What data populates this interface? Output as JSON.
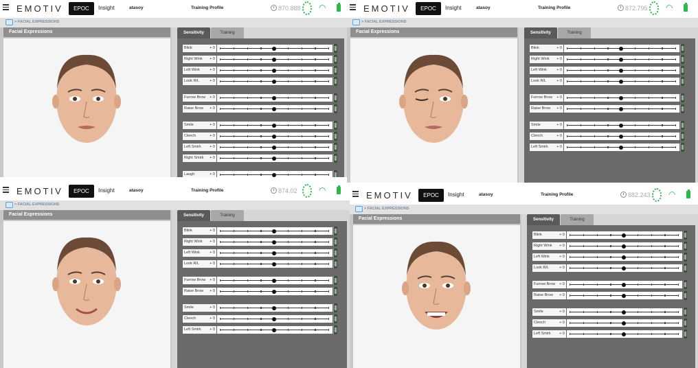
{
  "screens": [
    {
      "menu_icon": "hamburger-icon",
      "logo": "EMOTIV",
      "tabs": {
        "epoc": "EPOC",
        "insight": "Insight"
      },
      "user": "atasoy",
      "profile_label": "Training Profile",
      "counter": "870.888",
      "breadcrumb": "> FACIAL EXPRESSIONS",
      "panel_title": "Facial Expressions",
      "sensitivity_tab": "Sensitivity",
      "training_tab": "Training",
      "expression": "neutral",
      "sliders": [
        {
          "label": "Blink",
          "value": "+ 0",
          "level": 0.5
        },
        {
          "label": "Right Wink",
          "value": "+ 0",
          "level": 0.5
        },
        {
          "label": "Left Wink",
          "value": "+ 0",
          "level": 0.5
        },
        {
          "label": "Look R/L",
          "value": "+ 0",
          "level": 0.5
        },
        {
          "label": "Furrow Brow",
          "value": "+ 0",
          "level": 0.5,
          "gap": true
        },
        {
          "label": "Raise Brow",
          "value": "+ 0",
          "level": 0.5
        },
        {
          "label": "Smile",
          "value": "+ 0",
          "level": 0.5,
          "gap": true
        },
        {
          "label": "Clench",
          "value": "+ 0",
          "level": 0.5
        },
        {
          "label": "Left Smirk",
          "value": "+ 0",
          "level": 0.5
        },
        {
          "label": "Right Smirk",
          "value": "+ 0",
          "level": 0.5
        },
        {
          "label": "Laugh",
          "value": "+ 0",
          "level": 0.5,
          "gap": true
        }
      ]
    },
    {
      "menu_icon": "hamburger-icon",
      "logo": "EMOTIV",
      "tabs": {
        "epoc": "EPOC",
        "insight": "Insight"
      },
      "user": "atasoy",
      "profile_label": "Training Profile",
      "counter": "872.795",
      "breadcrumb": "> FACIAL EXPRESSIONS",
      "panel_title": "Facial Expressions",
      "sensitivity_tab": "Sensitivity",
      "training_tab": "Training",
      "expression": "wink",
      "sliders": [
        {
          "label": "Blink",
          "value": "+ 0",
          "level": 0.5
        },
        {
          "label": "Right Wink",
          "value": "+ 0",
          "level": 0.5
        },
        {
          "label": "Left Wink",
          "value": "+ 0",
          "level": 0.5
        },
        {
          "label": "Look R/L",
          "value": "+ 0",
          "level": 0.5
        },
        {
          "label": "Furrow Brow",
          "value": "+ 0",
          "level": 0.5,
          "gap": true
        },
        {
          "label": "Raise Brow",
          "value": "+ 0",
          "level": 0.5
        },
        {
          "label": "Smile",
          "value": "+ 0",
          "level": 0.5,
          "gap": true
        },
        {
          "label": "Clench",
          "value": "+ 0",
          "level": 0.5
        },
        {
          "label": "Left Smirk",
          "value": "+ 0",
          "level": 0.5
        }
      ]
    },
    {
      "menu_icon": "hamburger-icon",
      "logo": "EMOTIV",
      "tabs": {
        "epoc": "EPOC",
        "insight": "Insight"
      },
      "user": "atasoy",
      "profile_label": "Training Profile",
      "counter": "874.02",
      "breadcrumb": "> FACIAL EXPRESSIONS",
      "panel_title": "Facial Expressions",
      "sensitivity_tab": "Sensitivity",
      "training_tab": "Training",
      "expression": "smile",
      "sliders": [
        {
          "label": "Blink",
          "value": "+ 0",
          "level": 0.5
        },
        {
          "label": "Right Wink",
          "value": "+ 0",
          "level": 0.5
        },
        {
          "label": "Left Wink",
          "value": "+ 0",
          "level": 0.5
        },
        {
          "label": "Look R/L",
          "value": "+ 0",
          "level": 0.5
        },
        {
          "label": "Furrow Brow",
          "value": "+ 0",
          "level": 0.5,
          "gap": true
        },
        {
          "label": "Raise Brow",
          "value": "+ 0",
          "level": 0.5
        },
        {
          "label": "Smile",
          "value": "+ 0",
          "level": 0.5,
          "gap": true
        },
        {
          "label": "Clench",
          "value": "+ 0",
          "level": 0.5
        },
        {
          "label": "Left Smirk",
          "value": "+ 0",
          "level": 0.5
        }
      ]
    },
    {
      "menu_icon": "hamburger-icon",
      "logo": "EMOTIV",
      "tabs": {
        "epoc": "EPOC",
        "insight": "Insight"
      },
      "user": "atasoy",
      "profile_label": "Training Profile",
      "counter": "882.243",
      "breadcrumb": "> FACIAL EXPRESSIONS",
      "panel_title": "Facial Expressions",
      "sensitivity_tab": "Sensitivity",
      "training_tab": "Training",
      "expression": "clench",
      "sliders": [
        {
          "label": "Blink",
          "value": "+ 0",
          "level": 0.5
        },
        {
          "label": "Right Wink",
          "value": "+ 0",
          "level": 0.5
        },
        {
          "label": "Left Wink",
          "value": "+ 0",
          "level": 0.5
        },
        {
          "label": "Look R/L",
          "value": "+ 0",
          "level": 0.5
        },
        {
          "label": "Furrow Brow",
          "value": "+ 0",
          "level": 0.5,
          "gap": true
        },
        {
          "label": "Raise Brow",
          "value": "+ 0",
          "level": 0.5
        },
        {
          "label": "Smile",
          "value": "+ 0",
          "level": 0.5,
          "gap": true
        },
        {
          "label": "Clench",
          "value": "+ 0",
          "level": 0.5
        },
        {
          "label": "Left Smirk",
          "value": "+ 0",
          "level": 0.5
        }
      ]
    }
  ],
  "colors": {
    "accent_green": "#2db84b",
    "panel_dark": "#6a6a6a",
    "header_gray": "#8e8e8e"
  }
}
